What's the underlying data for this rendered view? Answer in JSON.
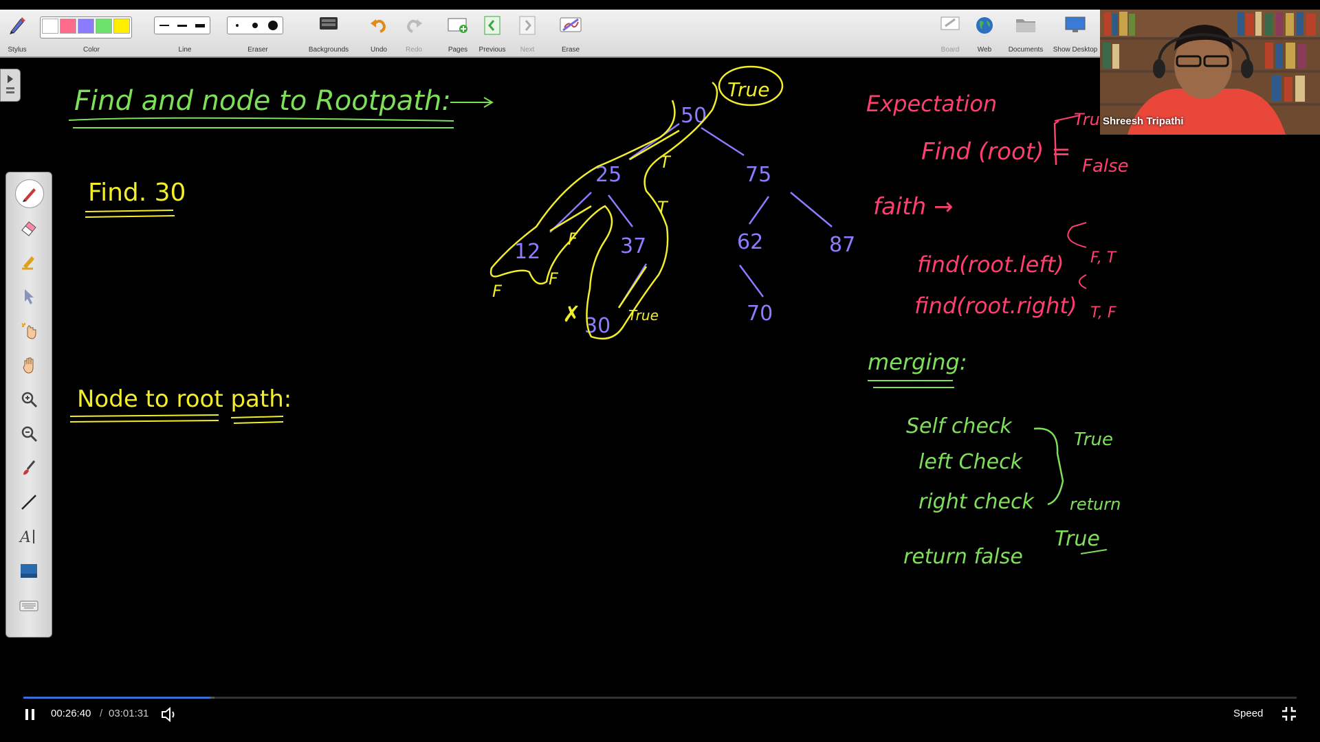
{
  "toolbar": {
    "stylus_label": "Stylus",
    "color_label": "Color",
    "line_label": "Line",
    "eraser_label": "Eraser",
    "backgrounds_label": "Backgrounds",
    "undo_label": "Undo",
    "redo_label": "Redo",
    "pages_label": "Pages",
    "previous_label": "Previous",
    "next_label": "Next",
    "erase_label": "Erase",
    "board_label": "Board",
    "web_label": "Web",
    "documents_label": "Documents",
    "show_desktop_label": "Show Desktop",
    "swatch_colors": [
      "#ffffff",
      "#ff6b8a",
      "#8a7bff",
      "#6be26b",
      "#ffee00"
    ]
  },
  "board": {
    "title_find_path": "Find and node to Rootpath:",
    "find_label": "Find. 30",
    "node_to_root_label": "Node to root path:",
    "tree_nodes": [
      "50",
      "25",
      "75",
      "12",
      "37",
      "62",
      "87",
      "30",
      "70"
    ],
    "true_circle_label": "True",
    "tree_annotations": [
      "T",
      "T",
      "F",
      "F",
      "F",
      "True"
    ],
    "expectation_title": "Expectation",
    "expectation_line": "Find (root) =",
    "expectation_true": "True",
    "expectation_false": "False",
    "faith_label": "faith →",
    "faith_left": "find(root.left)",
    "faith_right": "find(root.right)",
    "faith_left_results": "F, T",
    "faith_right_results": "T, F",
    "merging_label": "merging:",
    "merge_self": "Self check",
    "merge_left": "left Check",
    "merge_right": "right check",
    "merge_true": "True",
    "merge_return": "return",
    "merge_return_true": "True",
    "merge_return_false": "return false",
    "colors": {
      "yellow": "#f2ee2a",
      "green": "#7ee05a",
      "purple": "#8c7cff",
      "pink": "#ff3f6e"
    }
  },
  "webcam": {
    "name": "Shreesh Tripathi"
  },
  "player": {
    "current_time": "00:26:40",
    "separator": "/",
    "duration": "03:01:31",
    "speed_label": "Speed",
    "progress_fraction": 0.147,
    "buffered_fraction": 0.15
  }
}
